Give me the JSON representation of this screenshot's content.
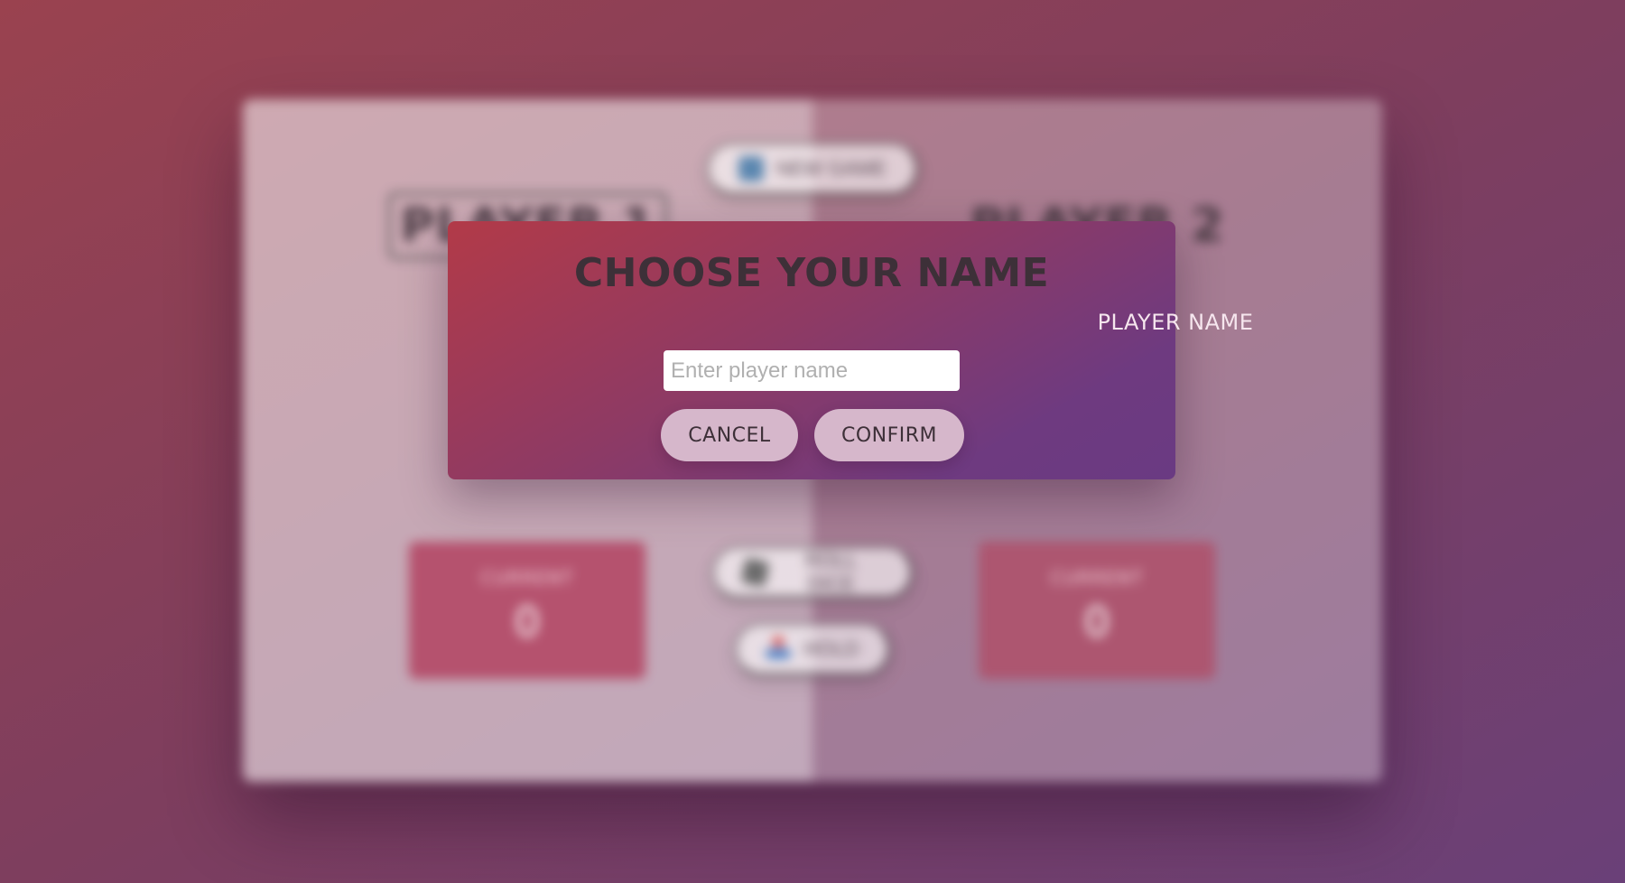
{
  "board": {
    "new_game_label": "NEW GAME",
    "roll_dice_label": "ROLL DICE",
    "hold_label": "HOLD",
    "players": [
      {
        "name": "PLAYER 1",
        "current_label": "CURRENT",
        "current_score": "0"
      },
      {
        "name": "PLAYER 2",
        "current_label": "CURRENT",
        "current_score": "0"
      }
    ]
  },
  "modal": {
    "title": "CHOOSE YOUR NAME",
    "label": "PLAYER NAME",
    "input_value": "",
    "input_placeholder": "Enter player name",
    "cancel_label": "CANCEL",
    "confirm_label": "CONFIRM"
  },
  "icons": {
    "new_game": "checkbox-icon",
    "roll_dice": "dice-icon",
    "hold": "hold-icon"
  }
}
